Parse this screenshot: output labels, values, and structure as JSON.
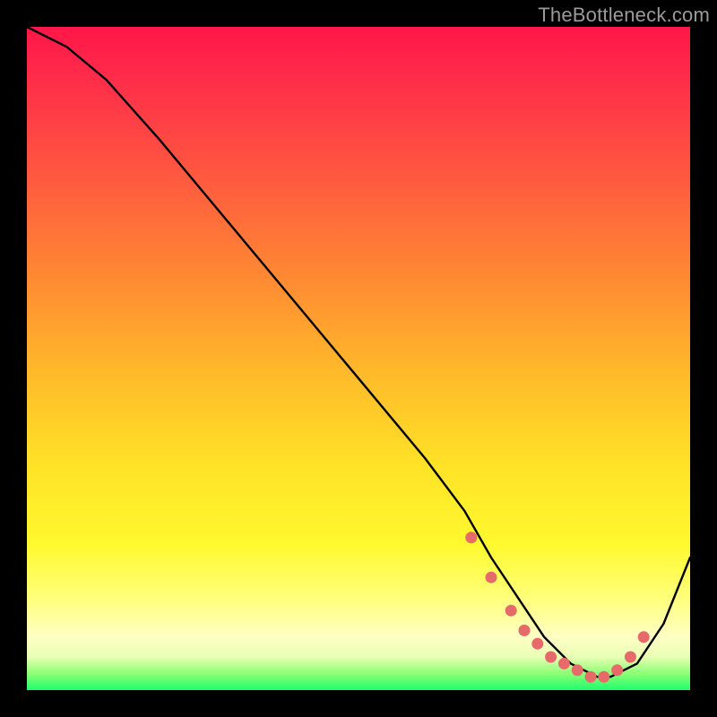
{
  "watermark": "TheBottleneck.com",
  "chart_data": {
    "type": "line",
    "title": "",
    "xlabel": "",
    "ylabel": "",
    "xlim": [
      0,
      100
    ],
    "ylim": [
      0,
      100
    ],
    "series": [
      {
        "name": "curve",
        "x": [
          0,
          6,
          12,
          20,
          30,
          40,
          50,
          60,
          66,
          70,
          74,
          78,
          82,
          86,
          88,
          92,
          96,
          100
        ],
        "values": [
          100,
          97,
          92,
          83,
          71,
          59,
          47,
          35,
          27,
          20,
          14,
          8,
          4,
          2,
          2,
          4,
          10,
          20
        ]
      }
    ],
    "markers": {
      "name": "highlight-dots",
      "color": "#e76a6a",
      "x": [
        67,
        70,
        73,
        75,
        77,
        79,
        81,
        83,
        85,
        87,
        89,
        91,
        93
      ],
      "values": [
        23,
        17,
        12,
        9,
        7,
        5,
        4,
        3,
        2,
        2,
        3,
        5,
        8
      ]
    },
    "background_gradient": {
      "top": "#ff1648",
      "mid": "#ffe227",
      "bottom": "#1dff6e"
    }
  }
}
